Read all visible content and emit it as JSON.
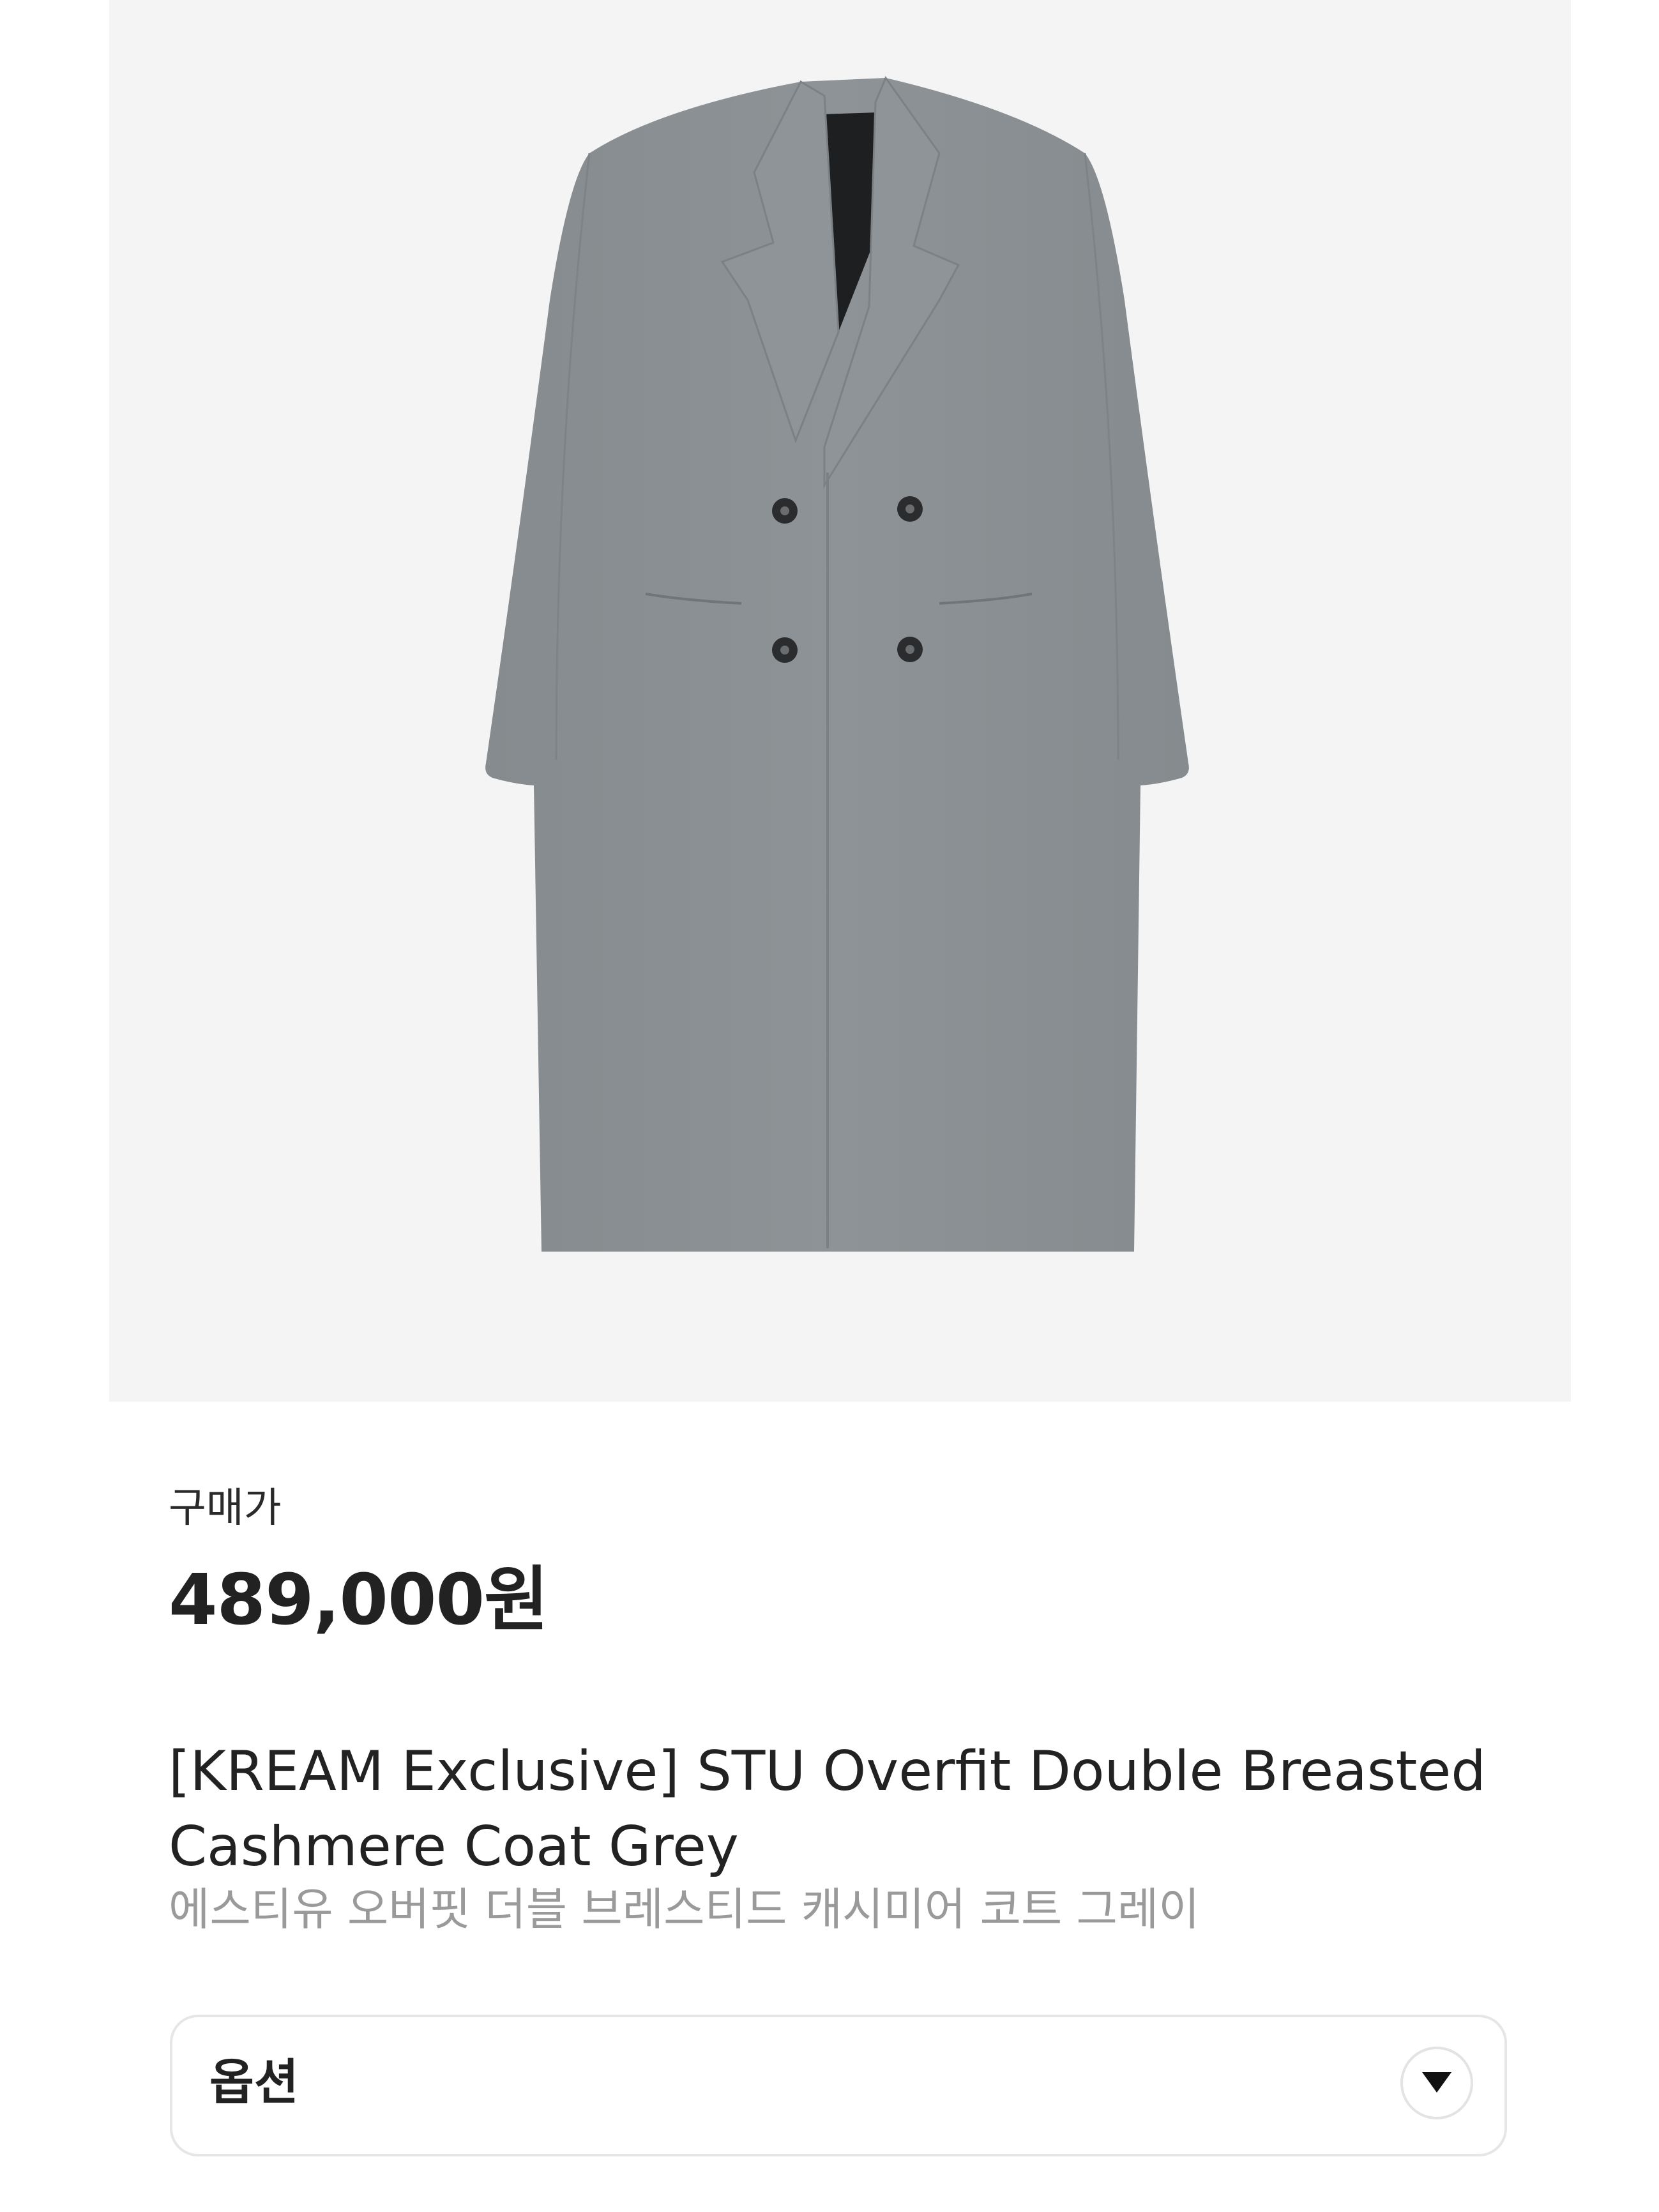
{
  "product": {
    "image_alt": "STU Overfit Double Breasted Cashmere Coat Grey",
    "image_bg_color": "#f4f4f4",
    "coat_color": "#8a9093"
  },
  "price": {
    "label": "구매가",
    "value": "489,000원"
  },
  "name": {
    "english": "[KREAM Exclusive] STU Overfit Double Breasted Cashmere Coat Grey",
    "korean": "에스티유 오버핏 더블 브레스티드 캐시미어 코트 그레이"
  },
  "option": {
    "label": "옵션",
    "toggle_icon": "chevron-down-icon"
  }
}
